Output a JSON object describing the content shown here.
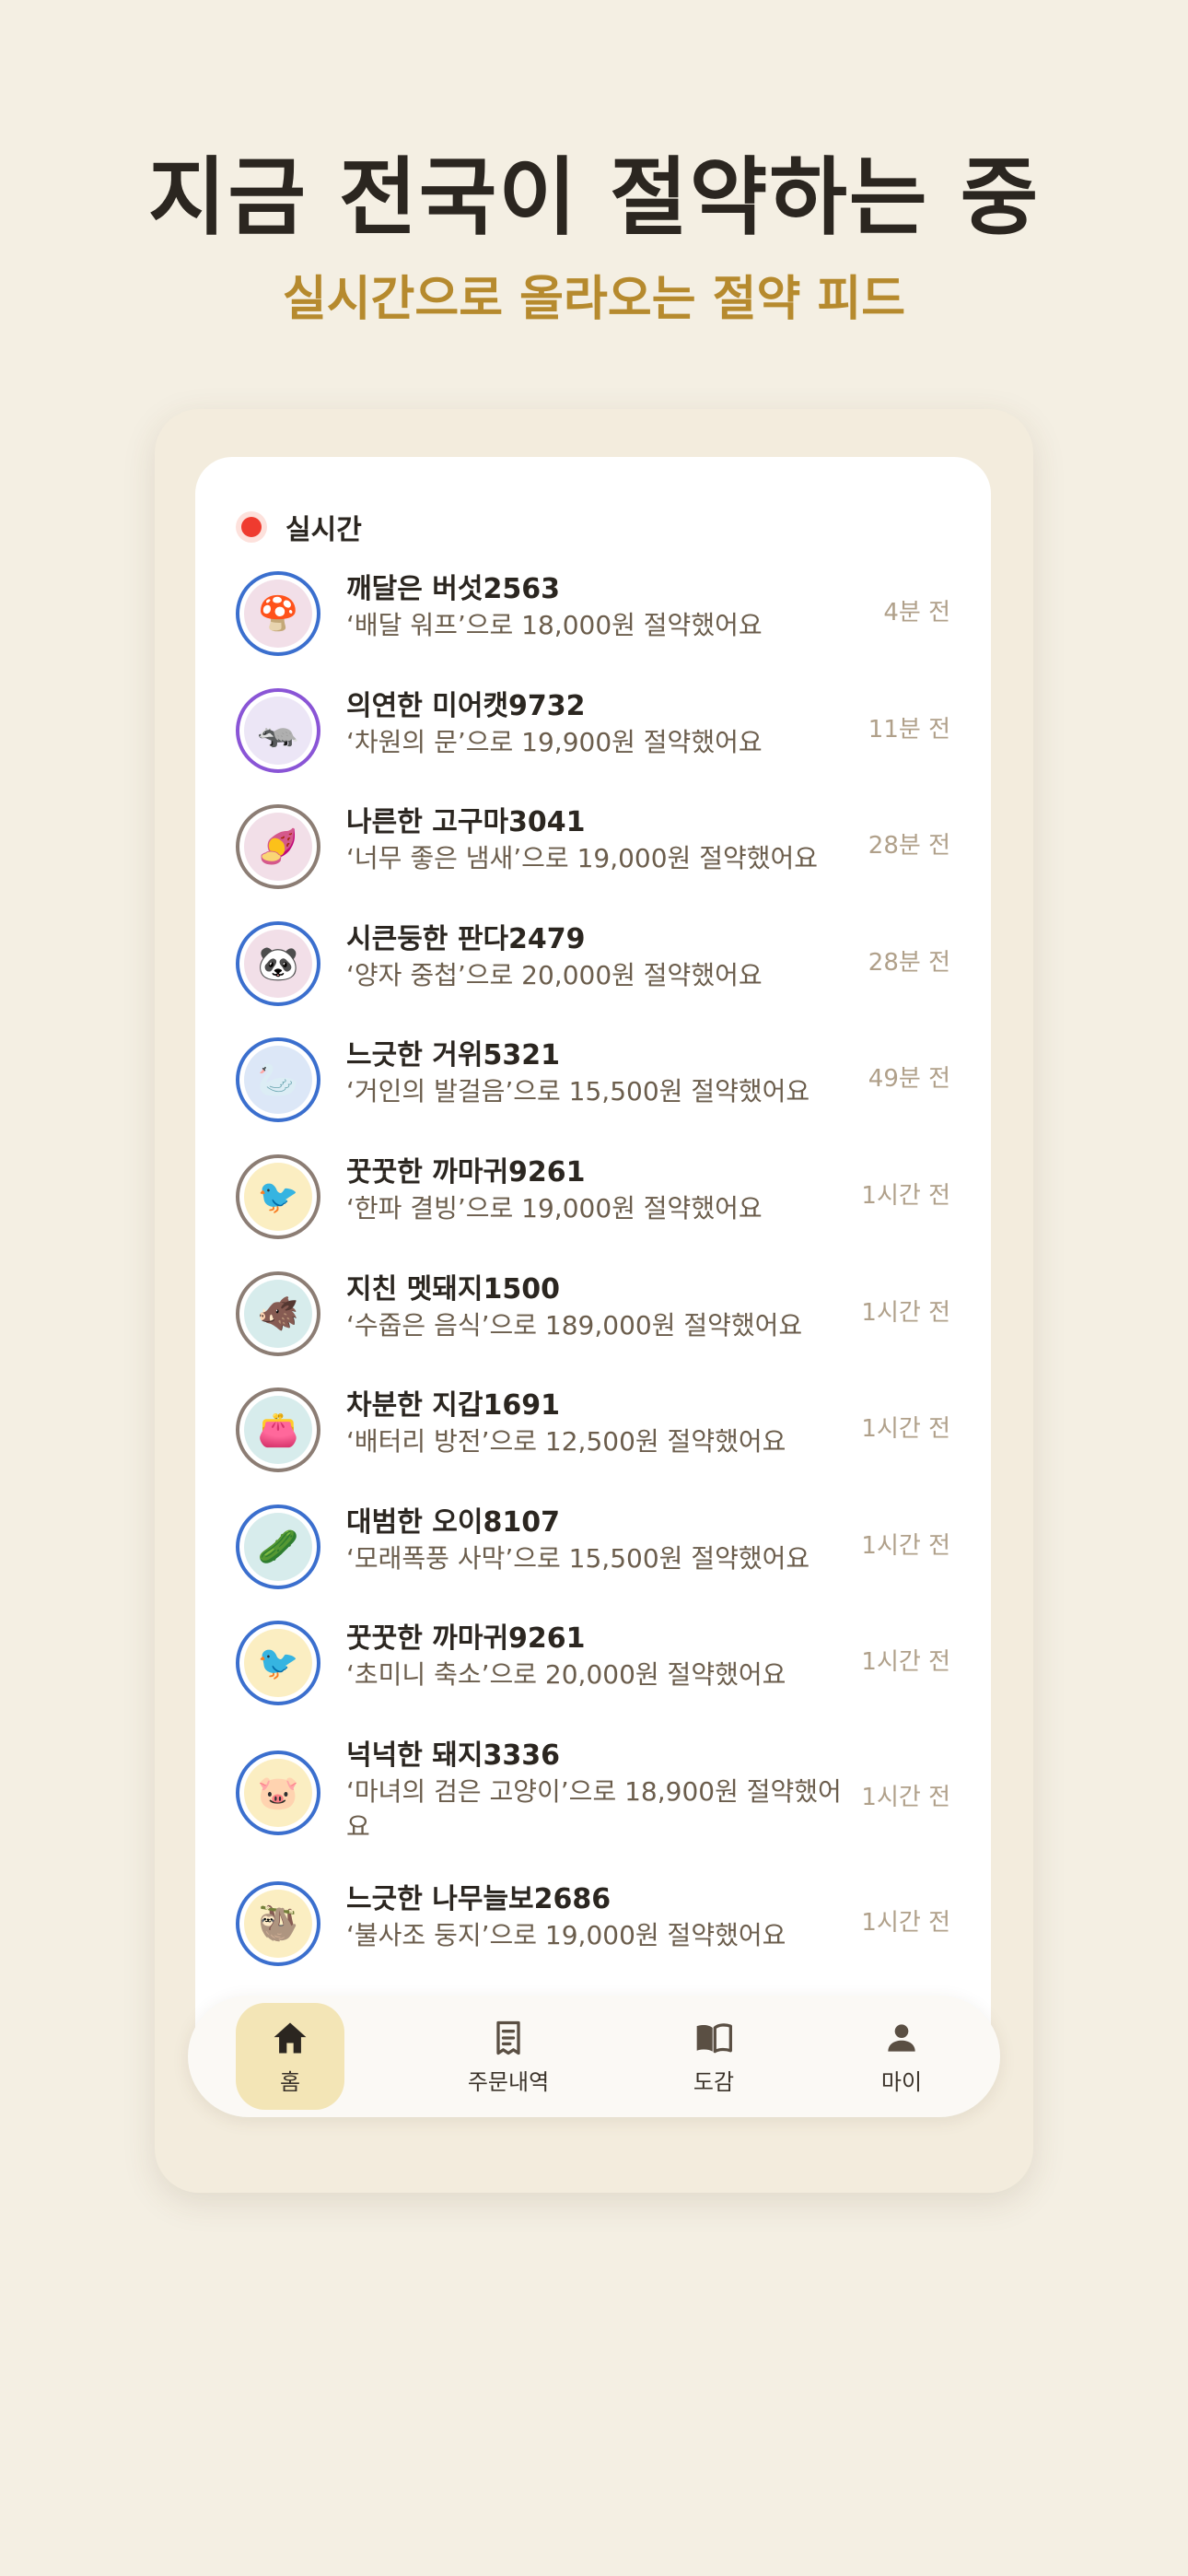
{
  "hero": {
    "title": "지금 전국이 절약하는 중",
    "subtitle": "실시간으로 올라오는 절약 피드"
  },
  "feed": {
    "label": "실시간",
    "items": [
      {
        "name": "깨달은 버섯2563",
        "desc": "‘배달 워프’으로 18,000원 절약했어요",
        "time": "4분 전",
        "emoji": "🍄",
        "ring": "#3b6fce",
        "bg": "#f2dfe8"
      },
      {
        "name": "의연한 미어캣9732",
        "desc": "‘차원의 문’으로 19,900원 절약했어요",
        "time": "11분 전",
        "emoji": "🦡",
        "ring": "#8a55d6",
        "bg": "#ece6f6"
      },
      {
        "name": "나른한 고구마3041",
        "desc": "‘너무 좋은 냄새’으로 19,000원 절약했어요",
        "time": "28분 전",
        "emoji": "🍠",
        "ring": "#8c7d74",
        "bg": "#f2dfe8"
      },
      {
        "name": "시큰둥한 판다2479",
        "desc": "‘양자 중첩’으로 20,000원 절약했어요",
        "time": "28분 전",
        "emoji": "🐼",
        "ring": "#3b6fce",
        "bg": "#f2dfe8"
      },
      {
        "name": "느긋한 거위5321",
        "desc": "‘거인의 발걸음’으로 15,500원 절약했어요",
        "time": "49분 전",
        "emoji": "🦢",
        "ring": "#3b6fce",
        "bg": "#dce7f7"
      },
      {
        "name": "꿋꿋한 까마귀9261",
        "desc": "‘한파 결빙’으로 19,000원 절약했어요",
        "time": "1시간 전",
        "emoji": "🐦",
        "ring": "#8c7d74",
        "bg": "#fbeec2"
      },
      {
        "name": "지친 멧돼지1500",
        "desc": "‘수줍은 음식’으로 189,000원 절약했어요",
        "time": "1시간 전",
        "emoji": "🐗",
        "ring": "#8c7d74",
        "bg": "#d7ecec"
      },
      {
        "name": "차분한 지갑1691",
        "desc": "‘배터리 방전’으로 12,500원 절약했어요",
        "time": "1시간 전",
        "emoji": "👛",
        "ring": "#8c7d74",
        "bg": "#d7ecec"
      },
      {
        "name": "대범한 오이8107",
        "desc": "‘모래폭풍 사막’으로 15,500원 절약했어요",
        "time": "1시간 전",
        "emoji": "🥒",
        "ring": "#3b6fce",
        "bg": "#d7ecec"
      },
      {
        "name": "꿋꿋한 까마귀9261",
        "desc": "‘초미니 축소’으로 20,000원 절약했어요",
        "time": "1시간 전",
        "emoji": "🐦",
        "ring": "#3b6fce",
        "bg": "#fbeec2"
      },
      {
        "name": "넉넉한 돼지3336",
        "desc": "‘마녀의 검은 고양이’으로 18,900원 절약했어요",
        "time": "1시간 전",
        "emoji": "🐷",
        "ring": "#3b6fce",
        "bg": "#fbeec2"
      },
      {
        "name": "느긋한 나무늘보2686",
        "desc": "‘불사조 둥지’으로 19,000원 절약했어요",
        "time": "1시간 전",
        "emoji": "🦥",
        "ring": "#3b6fce",
        "bg": "#fbeec2"
      }
    ]
  },
  "tabs": [
    {
      "label": "홈",
      "icon": "home-icon",
      "active": true
    },
    {
      "label": "주문내역",
      "icon": "receipt-icon",
      "active": false
    },
    {
      "label": "도감",
      "icon": "book-icon",
      "active": false
    },
    {
      "label": "마이",
      "icon": "person-icon",
      "active": false
    }
  ],
  "colors": {
    "accent": "#b68a2e",
    "live": "#ef3b2f",
    "background": "#f4efe3"
  }
}
